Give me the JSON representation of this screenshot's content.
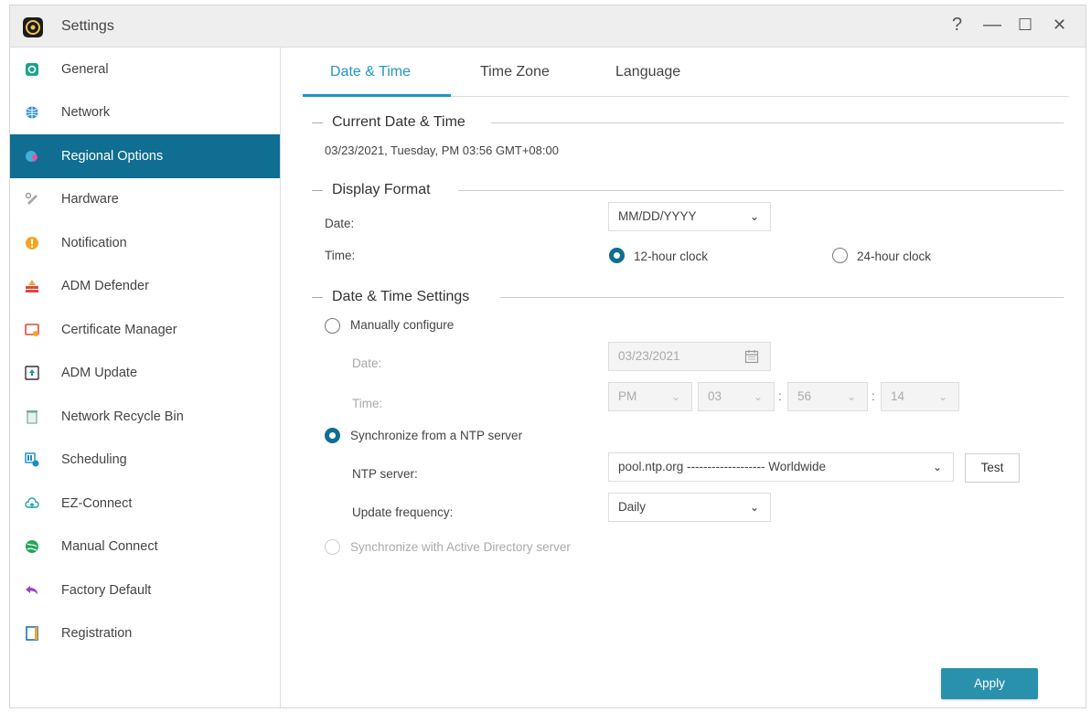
{
  "window": {
    "title": "Settings",
    "controls": {
      "help": "?",
      "minimize": "—",
      "maximize": "☐",
      "close": "✕"
    }
  },
  "colors": {
    "accent": "#1f97c1",
    "sidebar_active": "#0f6e91",
    "apply_button": "#2a91ad"
  },
  "sidebar": {
    "items": [
      {
        "label": "General",
        "icon": "general-icon"
      },
      {
        "label": "Network",
        "icon": "globe-icon"
      },
      {
        "label": "Regional Options",
        "icon": "regional-options-icon",
        "active": true
      },
      {
        "label": "Hardware",
        "icon": "hardware-icon"
      },
      {
        "label": "Notification",
        "icon": "notification-icon"
      },
      {
        "label": "ADM Defender",
        "icon": "defender-icon"
      },
      {
        "label": "Certificate Manager",
        "icon": "certificate-icon"
      },
      {
        "label": "ADM Update",
        "icon": "update-icon"
      },
      {
        "label": "Network Recycle Bin",
        "icon": "recycle-bin-icon"
      },
      {
        "label": "Scheduling",
        "icon": "scheduling-icon"
      },
      {
        "label": "EZ-Connect",
        "icon": "cloud-icon"
      },
      {
        "label": "Manual Connect",
        "icon": "manual-connect-icon"
      },
      {
        "label": "Factory Default",
        "icon": "undo-icon"
      },
      {
        "label": "Registration",
        "icon": "registration-icon"
      }
    ]
  },
  "tabs": [
    "Date & Time",
    "Time Zone",
    "Language"
  ],
  "current": {
    "title": "Current Date & Time",
    "value": "03/23/2021, Tuesday, PM 03:56 GMT+08:00"
  },
  "display_format": {
    "title": "Display Format",
    "date_label": "Date:",
    "date_value": "MM/DD/YYYY",
    "time_label": "Time:",
    "clock_12": "12-hour clock",
    "clock_24": "24-hour clock",
    "selected_clock": "12-hour clock"
  },
  "settings": {
    "title": "Date & Time Settings",
    "manual_label": "Manually configure",
    "date_label": "Date:",
    "date_value": "03/23/2021",
    "time_label": "Time:",
    "ampm": "PM",
    "hour": "03",
    "minute": "56",
    "second": "14",
    "time_sep": ":",
    "ntp_option": "Synchronize from a NTP server",
    "ntp_server_label": "NTP server:",
    "ntp_server_value": "pool.ntp.org ------------------- Worldwide",
    "test_label": "Test",
    "frequency_label": "Update frequency:",
    "frequency_value": "Daily",
    "ad_option": "Synchronize with Active Directory server",
    "selected": "Synchronize from a NTP server"
  },
  "apply_label": "Apply"
}
